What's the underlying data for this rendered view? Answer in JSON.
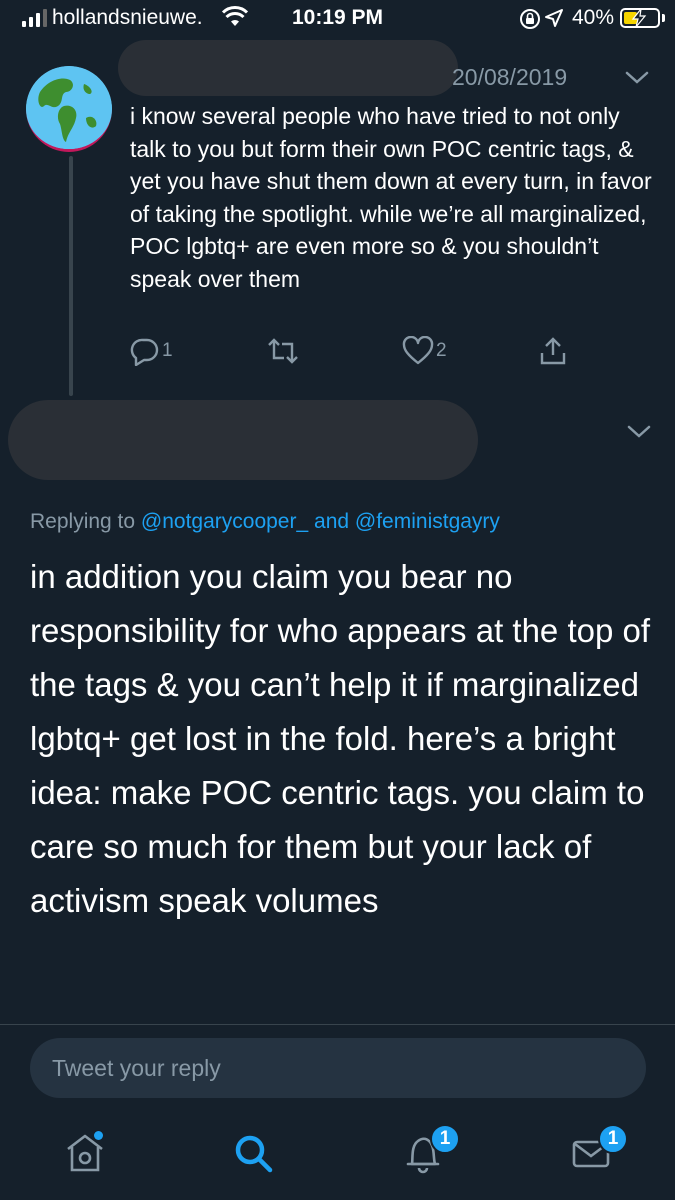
{
  "status_bar": {
    "carrier": "hollandsnieuwe.",
    "time": "10:19 PM",
    "battery_percent": "40%",
    "battery_level": 0.4,
    "battery_color": "#f5d400"
  },
  "thread_parent": {
    "avatar_icon": "earth-globe-icon",
    "date": "20/08/2019",
    "text": "i know several people who have tried to not only talk to you but form their own POC centric tags, & yet you have shut them down at every turn, in favor of taking the spotlight. while we’re all marginalized, POC lgbtq+ are even more so & you shouldn’t speak over them",
    "actions": {
      "reply_count": "1",
      "retweet_count": "",
      "like_count": "2"
    }
  },
  "main_tweet": {
    "replying_prefix": "Replying to",
    "mention_1": "@notgarycooper_",
    "joiner": "and",
    "mention_2": "@feministgayry",
    "text": "in addition you claim you bear no responsibility for who appears at the top of the tags & you can’t help it if marginalized lgbtq+ get lost in the fold. here’s a bright idea: make POC centric tags. you claim to care so much for them but your lack of activism speak volumes"
  },
  "reply_box": {
    "placeholder": "Tweet your reply"
  },
  "tab_bar": {
    "notifications_badge": "1",
    "messages_badge": "1"
  },
  "colors": {
    "background": "#15202b",
    "accent": "#1da1f2",
    "muted": "#8899a6"
  }
}
